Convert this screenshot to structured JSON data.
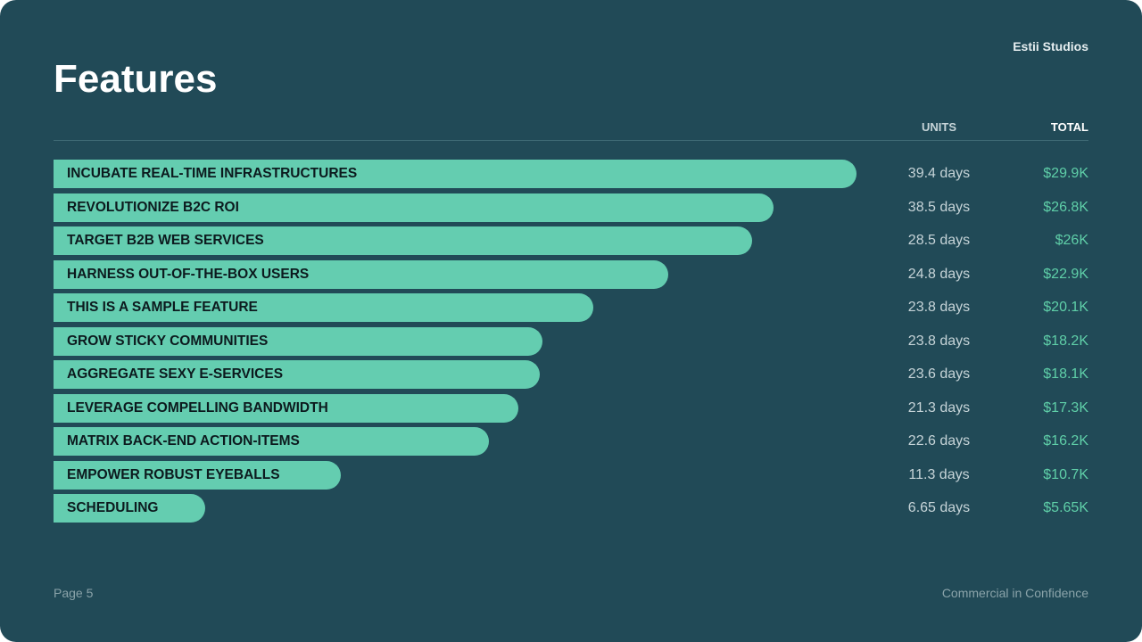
{
  "header": {
    "brand": "Estii Studios",
    "title": "Features"
  },
  "columns": {
    "units": "UNITS",
    "total": "TOTAL"
  },
  "colors": {
    "background": "#214a57",
    "bar": "#64cdb0",
    "total_text": "#5fcfa8"
  },
  "chart_data": {
    "type": "bar",
    "orientation": "horizontal",
    "categories": [
      "INCUBATE REAL-TIME INFRASTRUCTURES",
      "REVOLUTIONIZE B2C ROI",
      "TARGET B2B WEB SERVICES",
      "HARNESS OUT-OF-THE-BOX USERS",
      "THIS IS A SAMPLE FEATURE",
      "GROW STICKY COMMUNITIES",
      "AGGREGATE SEXY E-SERVICES",
      "LEVERAGE COMPELLING BANDWIDTH",
      "MATRIX BACK-END ACTION-ITEMS",
      "EMPOWER ROBUST EYEBALLS",
      "SCHEDULING"
    ],
    "values": [
      29.9,
      26.8,
      26,
      22.9,
      20.1,
      18.2,
      18.1,
      17.3,
      16.2,
      10.7,
      5.65
    ],
    "units_labels": [
      "39.4 days",
      "38.5 days",
      "28.5 days",
      "24.8 days",
      "23.8 days",
      "23.8 days",
      "23.6 days",
      "21.3 days",
      "22.6 days",
      "11.3 days",
      "6.65 days"
    ],
    "total_labels": [
      "$29.9K",
      "$26.8K",
      "$26K",
      "$22.9K",
      "$20.1K",
      "$18.2K",
      "$18.1K",
      "$17.3K",
      "$16.2K",
      "$10.7K",
      "$5.65K"
    ]
  },
  "footer": {
    "page": "Page 5",
    "confidentiality": "Commercial in Confidence"
  }
}
